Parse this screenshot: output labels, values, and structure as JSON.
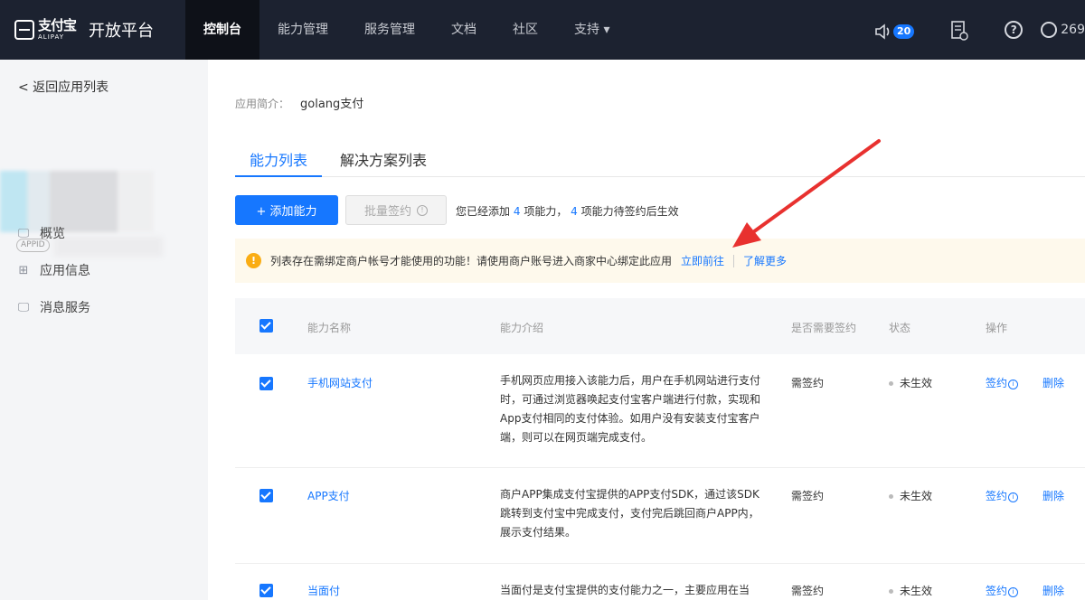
{
  "nav": {
    "brand_cn": "支付宝",
    "brand_en": "ALIPAY",
    "brand_title": "开放平台",
    "items": [
      "控制台",
      "能力管理",
      "服务管理",
      "文档",
      "社区",
      "支持 ▾"
    ],
    "notify_count": "20",
    "user_text": "269"
  },
  "sidebar": {
    "back": "< 返回应用列表",
    "appid": "APPID",
    "items": [
      {
        "icon": "monitor-icon",
        "label": "概览"
      },
      {
        "icon": "grid-icon",
        "label": "应用信息"
      },
      {
        "icon": "message-icon",
        "label": "消息服务"
      }
    ]
  },
  "main": {
    "intro_label": "应用简介：",
    "intro_value": "golang支付",
    "tabs": [
      "能力列表",
      "解决方案列表"
    ],
    "add_button": "+ 添加能力",
    "batch_button": "批量签约",
    "added_pre": "您已经添加",
    "added_count": "4",
    "added_mid": "项能力，",
    "pending_count": "4",
    "added_post": "项能力待签约后生效",
    "notice_text": "列表存在需绑定商户帐号才能使用的功能！请使用商户账号进入商家中心绑定此应用",
    "notice_link1": "立即前往",
    "notice_link2": "了解更多"
  },
  "table": {
    "headers": [
      "能力名称",
      "能力介绍",
      "是否需要签约",
      "状态",
      "操作"
    ],
    "rows": [
      {
        "name": "手机网站支付",
        "desc": "手机网页应用接入该能力后，用户在手机网站进行支付时，可通过浏览器唤起支付宝客户端进行付款，实现和App支付相同的支付体验。如用户没有安装支付宝客户端，则可以在网页端完成支付。",
        "sign": "需签约",
        "status": "未生效",
        "op1": "签约",
        "op2": "删除"
      },
      {
        "name": "APP支付",
        "desc": "商户APP集成支付宝提供的APP支付SDK，通过该SDK 跳转到支付宝中完成支付，支付完后跳回商户APP内，展示支付结果。",
        "sign": "需签约",
        "status": "未生效",
        "op1": "签约",
        "op2": "删除"
      },
      {
        "name": "当面付",
        "desc": "当面付是支付宝提供的支付能力之一，主要应用在当",
        "sign": "需签约",
        "status": "未生效",
        "op1": "签约",
        "op2": "删除"
      }
    ]
  }
}
